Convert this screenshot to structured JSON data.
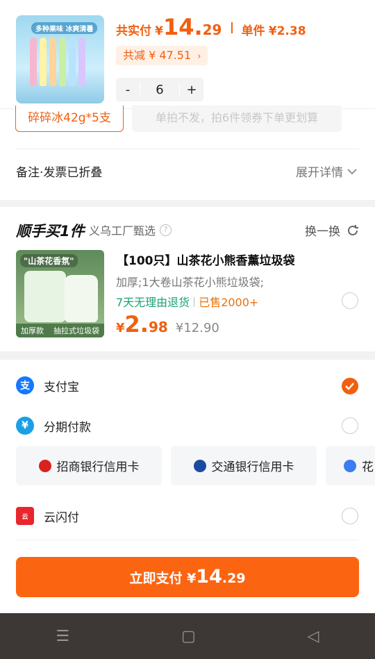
{
  "product": {
    "image_tag": "多种果味 冰爽清暑",
    "total_label": "共实付",
    "currency": "¥",
    "total_int": "14.",
    "total_dec": "29",
    "unit_label": "单件",
    "unit_price": "¥2.38",
    "reduce_text": "共减 ¥ 47.51",
    "qty_minus": "-",
    "qty_value": "6",
    "qty_plus": "+"
  },
  "spec": {
    "active": "碎碎冰42g*5支",
    "note": "单拍不发，拍6件领券下单更划算"
  },
  "remark": {
    "label": "备注·发票已折叠",
    "expand": "展开详情"
  },
  "recommend": {
    "title": "顺手买1件",
    "subtitle": "义乌工厂甄选",
    "swap": "换一换",
    "img_tag": "\"山茶花香氛\"",
    "img_foot_left": "加厚款",
    "img_foot_right": "抽拉式垃圾袋",
    "name": "【100只】山茶花小熊香薰垃圾袋",
    "desc": "加厚;1大卷山茶花小熊垃圾袋;",
    "tag_return": "7天无理由退货",
    "tag_sold": "已售2000+",
    "price_yen": "¥",
    "price_int": "2.",
    "price_dec": "98",
    "price_orig": "¥12.90"
  },
  "payment": {
    "methods": [
      {
        "label": "支付宝",
        "icon": "alipay-icon",
        "selected": true
      },
      {
        "label": "分期付款",
        "icon": "installment-icon",
        "selected": false
      },
      {
        "label": "云闪付",
        "icon": "unionpay-icon",
        "selected": false
      }
    ],
    "banks": [
      "招商银行信用卡",
      "交通银行信用卡",
      "花"
    ],
    "pay_label": "立即支付 ¥",
    "pay_int": "14",
    "pay_dec": ".29",
    "colors": {
      "accent": "#fb6512",
      "alipay": "#1677ff",
      "green": "#19a27a"
    }
  },
  "nav": {
    "menu": "☰",
    "home": "▢",
    "back": "◁"
  }
}
